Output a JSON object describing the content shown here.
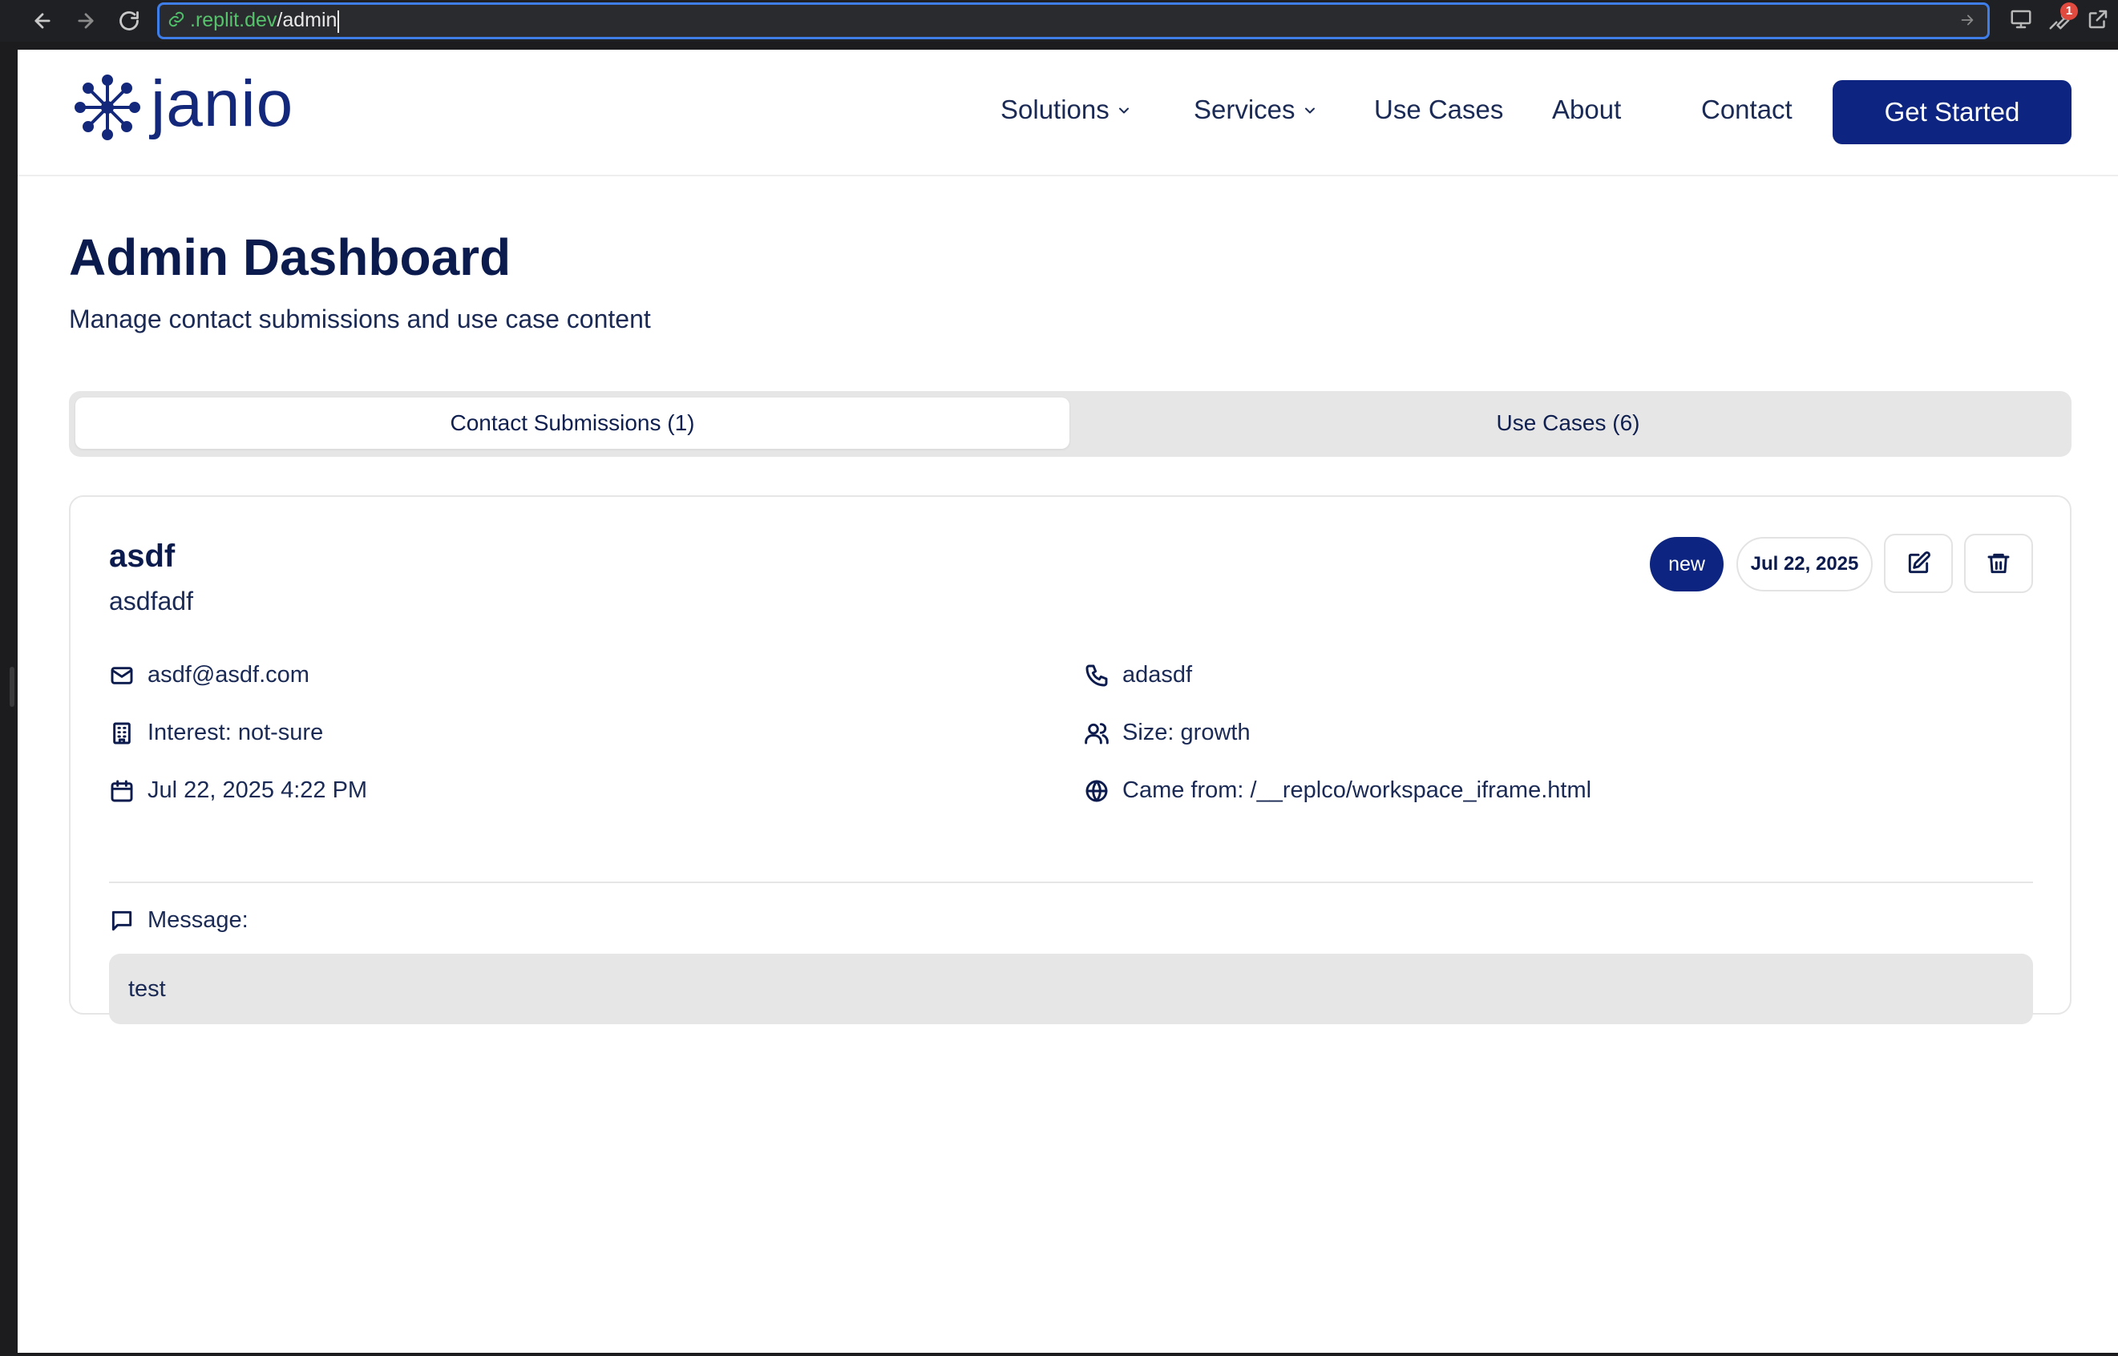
{
  "browser": {
    "url_host": ".replit.dev",
    "url_path": "/admin",
    "extension_badge": "1"
  },
  "site": {
    "logo_text": "janio",
    "nav": {
      "solutions": "Solutions",
      "services": "Services",
      "use_cases": "Use Cases",
      "about": "About",
      "contact": "Contact",
      "get_started": "Get Started"
    }
  },
  "page": {
    "title": "Admin Dashboard",
    "subtitle": "Manage contact submissions and use case content"
  },
  "tabs": [
    {
      "label": "Contact Submissions (1)",
      "active": true
    },
    {
      "label": "Use Cases (6)",
      "active": false
    }
  ],
  "submission": {
    "name": "asdf",
    "company": "asdfadf",
    "status": "new",
    "date_badge": "Jul 22, 2025",
    "email": "asdf@asdf.com",
    "phone": "adasdf",
    "interest": "Interest: not-sure",
    "size": "Size: growth",
    "submitted_at": "Jul 22, 2025 4:22 PM",
    "came_from": "Came from: /__replco/workspace_iframe.html",
    "message_label": "Message:",
    "message": "test"
  },
  "colors": {
    "brand": "#0d2580",
    "text": "#0c1b4d",
    "tab_bg": "#e6e6e6",
    "url_focus": "#3f7ee8",
    "url_host": "#57c26c"
  }
}
